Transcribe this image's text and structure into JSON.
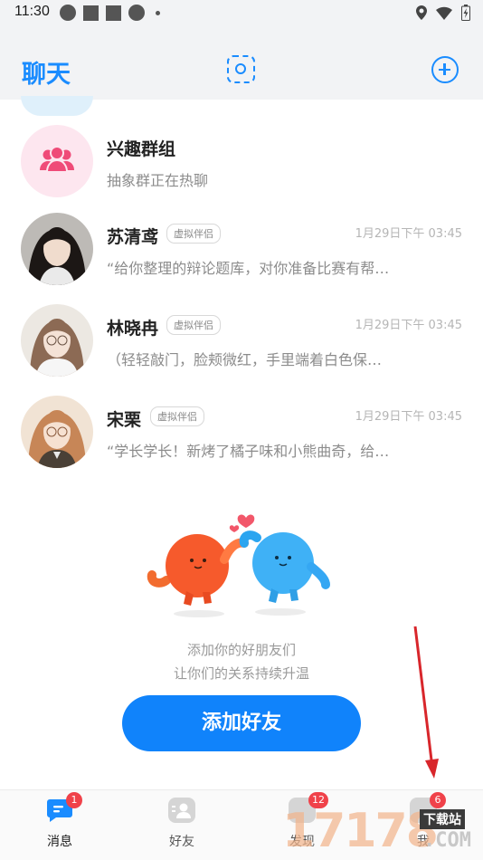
{
  "status_bar": {
    "time": "11:30"
  },
  "header": {
    "title": "聊天"
  },
  "chats": [
    {
      "name": "兴趣群组",
      "tag": "",
      "time": "",
      "message": "抽象群正在热聊"
    },
    {
      "name": "苏清鸢",
      "tag": "虚拟伴侣",
      "time": "1月29日下午 03:45",
      "message": "“给你整理的辩论题库，对你准备比赛有帮…"
    },
    {
      "name": "林晓冉",
      "tag": "虚拟伴侣",
      "time": "1月29日下午 03:45",
      "message": "（轻轻敲门，脸颊微红，手里端着白色保…"
    },
    {
      "name": "宋栗",
      "tag": "虚拟伴侣",
      "time": "1月29日下午 03:45",
      "message": "“学长学长！新烤了橘子味和小熊曲奇，给…"
    }
  ],
  "empty_state": {
    "line1": "添加你的好朋友们",
    "line2": "让你们的关系持续升温",
    "button": "添加好友"
  },
  "tabs": [
    {
      "label": "消息",
      "icon": "message-icon",
      "badge": "1",
      "active": true
    },
    {
      "label": "好友",
      "icon": "friends-icon",
      "badge": "",
      "active": false
    },
    {
      "label": "发现",
      "icon": "discover-icon",
      "badge": "12",
      "active": false
    },
    {
      "label": "我",
      "icon": "me-icon",
      "badge": "6",
      "active": false
    }
  ],
  "watermark": {
    "number": "17178",
    "download": "下载站",
    "domain": ".COM"
  },
  "colors": {
    "accent": "#1a8cff",
    "badge": "#f0424a",
    "annotation_arrow": "#d8262b"
  }
}
